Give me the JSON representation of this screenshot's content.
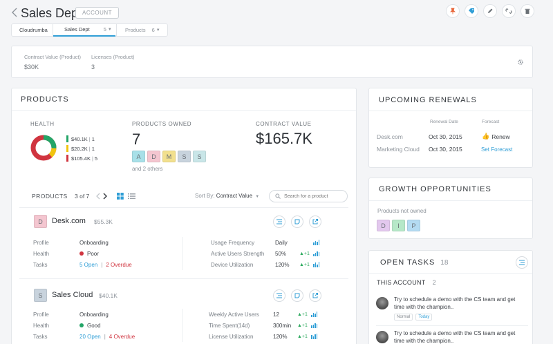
{
  "header": {
    "title": "Sales Dept",
    "account_badge": "ACCOUNT"
  },
  "breadcrumb": {
    "items": [
      {
        "label": "Cloudrumba",
        "count": ""
      },
      {
        "label": "Sales Dept",
        "count": "5"
      },
      {
        "label": "Products",
        "count": "6"
      }
    ]
  },
  "summary": {
    "fields": [
      {
        "label": "Contract Value (Product)",
        "value": "$30K"
      },
      {
        "label": "Licenses (Product)",
        "value": "3"
      }
    ]
  },
  "products_panel": {
    "title": "PRODUCTS",
    "health_label": "HEALTH",
    "health_legend": [
      {
        "value": "$40.1K",
        "count": "1",
        "color": "#23a567"
      },
      {
        "value": "$20.2K",
        "count": "1",
        "color": "#f1c40f"
      },
      {
        "value": "$105.4K",
        "count": "5",
        "color": "#d0343f"
      }
    ],
    "owned_label": "PRODUCTS OWNED",
    "owned_count": "7",
    "owned_tiles": [
      {
        "letter": "A",
        "color": "#a8e0e8"
      },
      {
        "letter": "D",
        "color": "#f4c6d0"
      },
      {
        "letter": "M",
        "color": "#f2e08e"
      },
      {
        "letter": "S",
        "color": "#c8d3dd"
      },
      {
        "letter": "S",
        "color": "#c9e6e8"
      }
    ],
    "owned_more": "and 2 others",
    "contract_label": "CONTRACT VALUE",
    "contract_value": "$165.7K",
    "list_label": "PRODUCTS",
    "pager": "3 of 7",
    "sort_prefix": "Sort By:",
    "sort_value": "Contract Value",
    "search_placeholder": "Search for a product",
    "products": [
      {
        "letter": "D",
        "tile_color": "#f4c6d0",
        "name": "Desk.com",
        "price": "$55.3K",
        "profile_label": "Profile",
        "profile": "Onboarding",
        "health_label": "Health",
        "health": "Poor",
        "health_color": "#d0343f",
        "tasks_label": "Tasks",
        "tasks_open": "5 Open",
        "tasks_overdue": "2 Overdue",
        "metrics": [
          {
            "label": "Usage Frequency",
            "value": "Daily",
            "delta": "",
            "bars": [
              4,
              6,
              5,
              8
            ]
          },
          {
            "label": "Active Users Strength",
            "value": "50%",
            "delta": "▲+1",
            "bars": [
              3,
              5,
              7,
              6
            ]
          },
          {
            "label": "Device Utilization",
            "value": "120%",
            "delta": "▲+1",
            "bars": [
              5,
              7,
              4,
              8
            ]
          }
        ]
      },
      {
        "letter": "S",
        "tile_color": "#c8d3dd",
        "name": "Sales Cloud",
        "price": "$40.1K",
        "profile_label": "Profile",
        "profile": "Onboarding",
        "health_label": "Health",
        "health": "Good",
        "health_color": "#23a567",
        "tasks_label": "Tasks",
        "tasks_open": "20 Open",
        "tasks_overdue": "4 Overdue",
        "metrics": [
          {
            "label": "Weekly Active Users",
            "value": "12",
            "delta": "▲+1",
            "bars": [
              3,
              6,
              5,
              8
            ]
          },
          {
            "label": "Time Spent(14d)",
            "value": "300min",
            "delta": "▲+1",
            "bars": [
              4,
              5,
              7,
              6
            ]
          },
          {
            "label": "License Utilization",
            "value": "120%",
            "delta": "▲+1",
            "bars": [
              6,
              4,
              7,
              8
            ]
          }
        ]
      }
    ]
  },
  "renewals": {
    "title": "UPCOMING RENEWALS",
    "col_date": "Renewal Date",
    "col_forecast": "Forecast",
    "rows": [
      {
        "name": "Desk.com",
        "date": "Oct 30, 2015",
        "forecast": "Renew"
      },
      {
        "name": "Marketing Cloud",
        "date": "Oct 30, 2015",
        "forecast": "Set Forecast"
      }
    ]
  },
  "growth": {
    "title": "GROWTH OPPORTUNITIES",
    "subtitle": "Products not owned",
    "tiles": [
      {
        "letter": "D",
        "color": "#e3c8ee"
      },
      {
        "letter": "I",
        "color": "#b6e8c8"
      },
      {
        "letter": "P",
        "color": "#b4dbf2"
      }
    ]
  },
  "tasks": {
    "title": "OPEN TASKS",
    "count": "18",
    "this_account_label": "THIS ACCOUNT",
    "this_account_count": "2",
    "items": [
      {
        "text": "Try to schedule a demo with the CS team and get time with the champion..",
        "tags": [
          "Normal",
          "Today"
        ]
      },
      {
        "text": "Try to schedule a demo with the CS team and get time with the champion..",
        "tags": []
      }
    ]
  }
}
